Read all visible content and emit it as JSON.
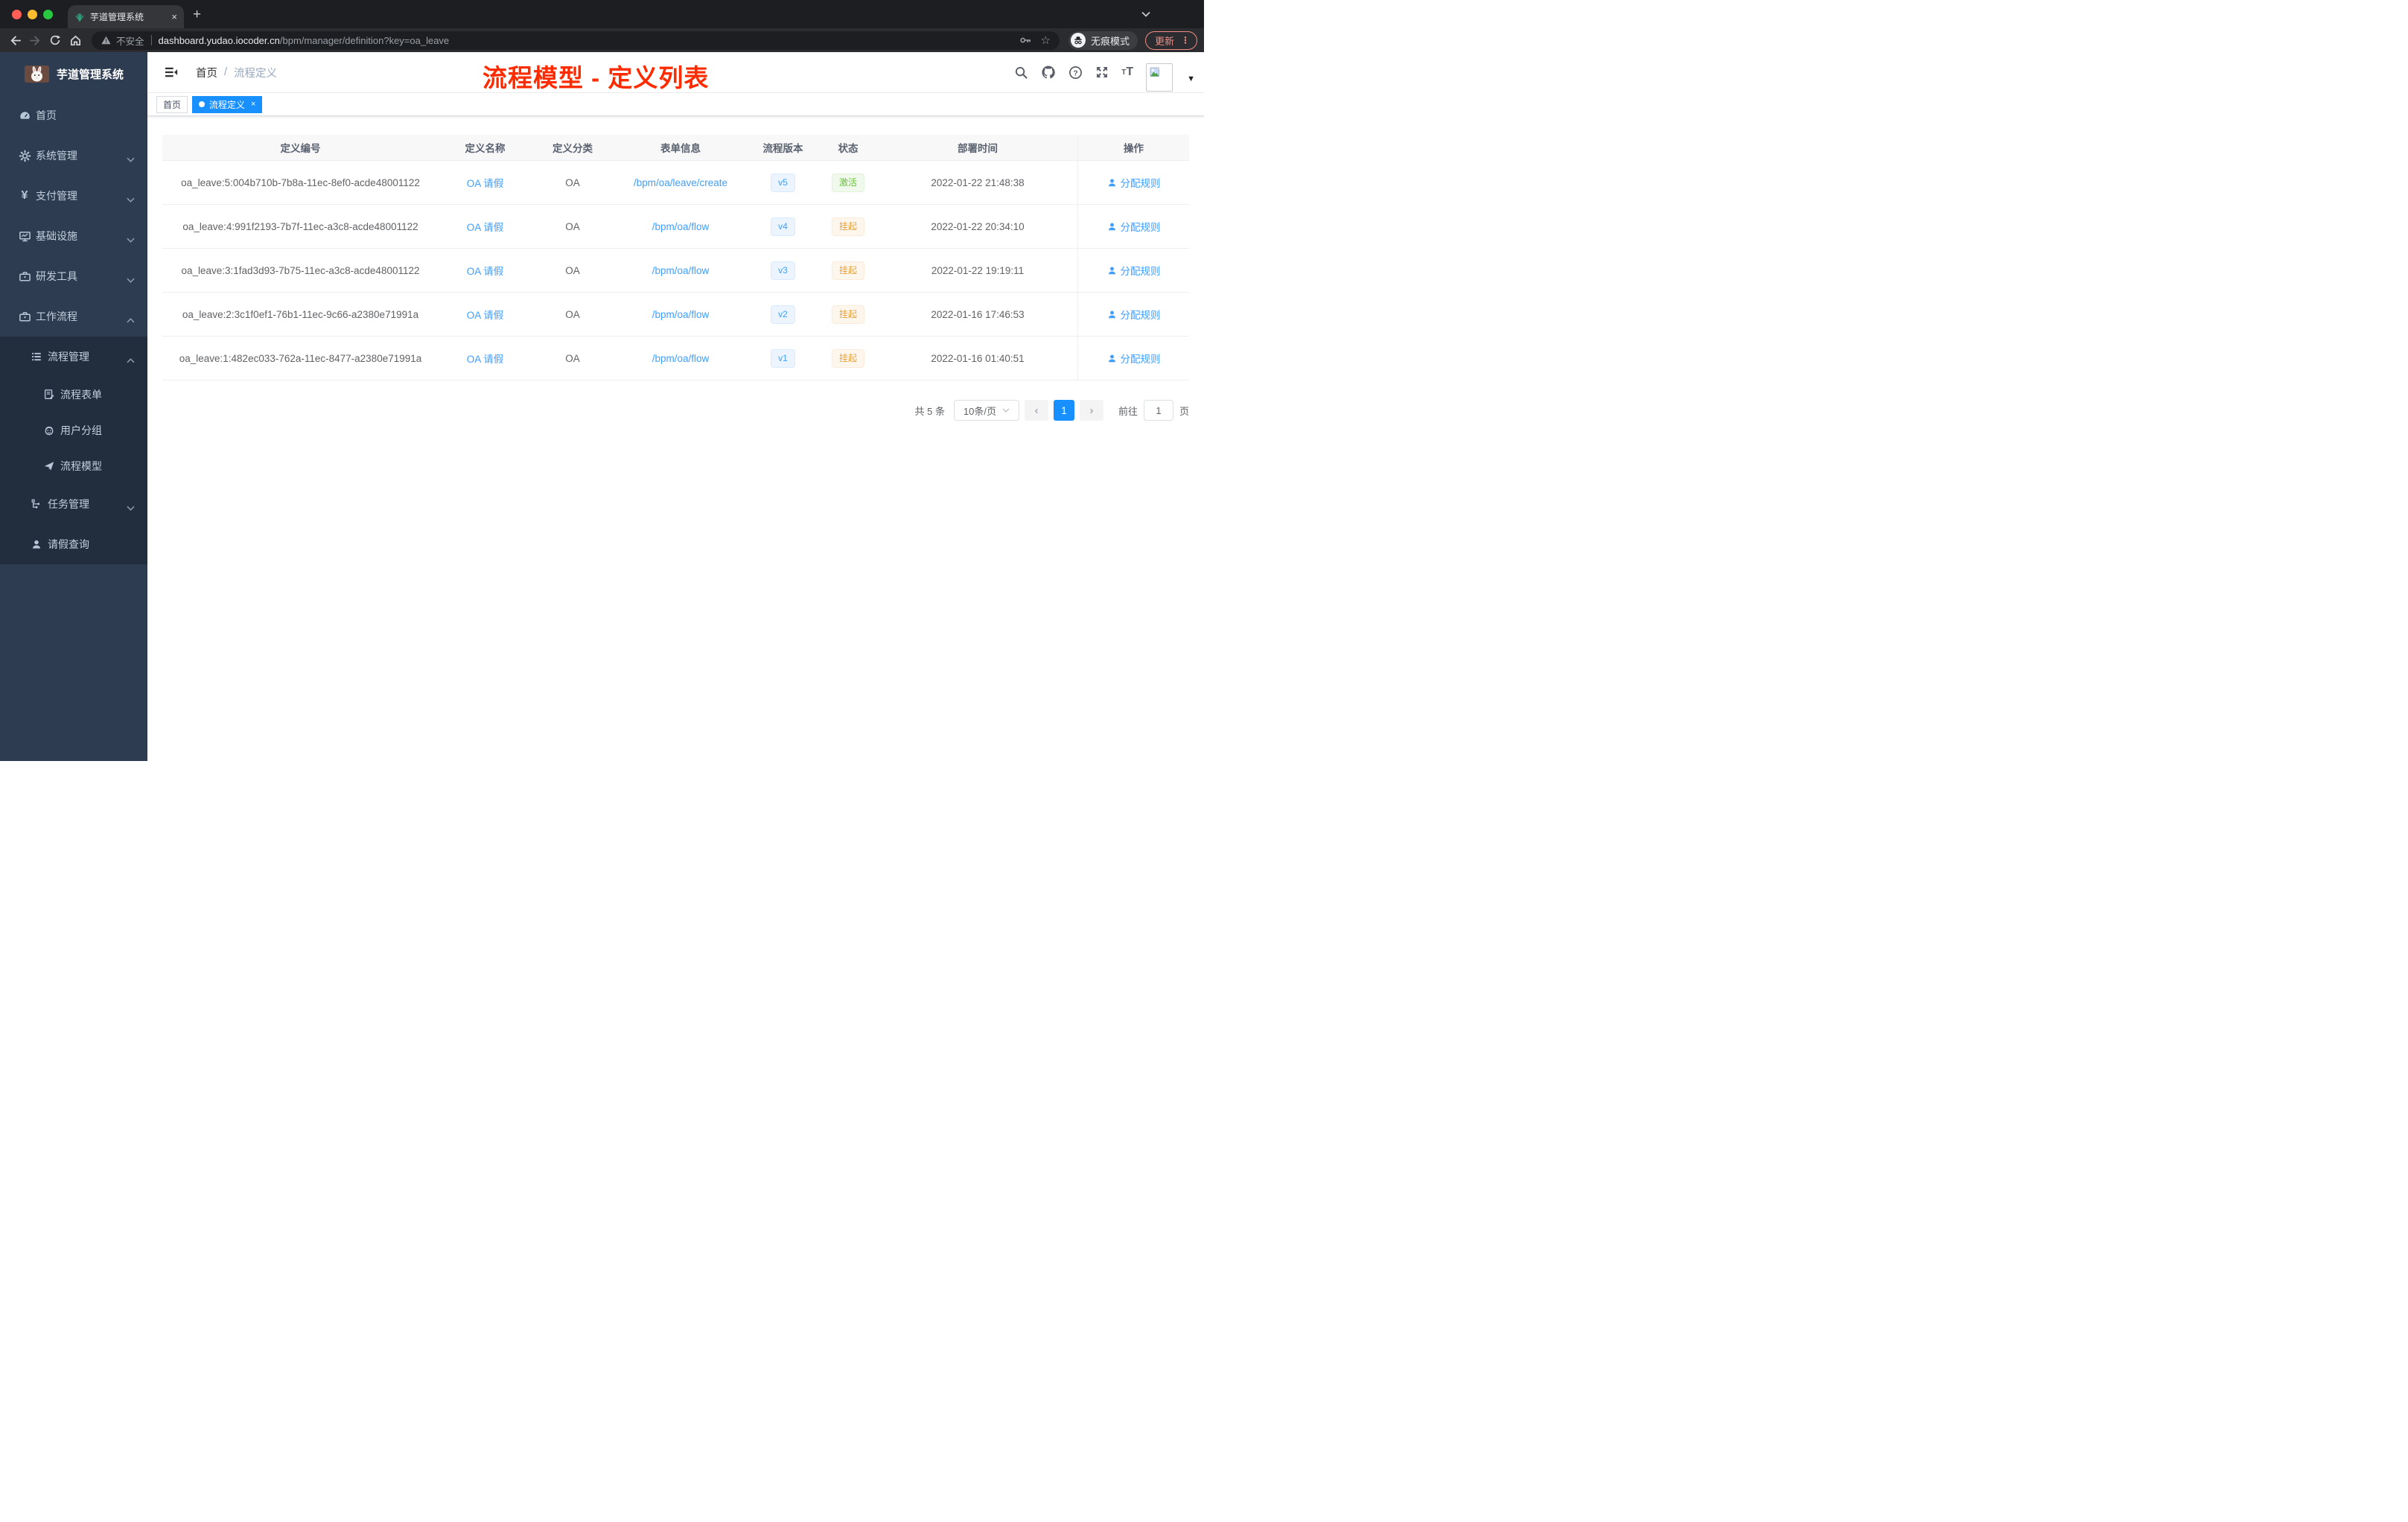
{
  "browser": {
    "tab": {
      "title": "芋道管理系统",
      "close": "×"
    },
    "new_tab": "+",
    "address": {
      "security_label": "不安全",
      "host": "dashboard.yudao.iocoder.cn",
      "path": "/bpm/manager/definition?key=oa_leave"
    },
    "incognito_label": "无痕模式",
    "update_label": "更新",
    "menu_dots": "⋮"
  },
  "sidebar": {
    "logo_title": "芋道管理系统",
    "items": [
      {
        "label": "首页",
        "icon": "dashboard-icon"
      },
      {
        "label": "系统管理",
        "icon": "gear-icon"
      },
      {
        "label": "支付管理",
        "icon": "yen-icon"
      },
      {
        "label": "基础设施",
        "icon": "monitor-icon"
      },
      {
        "label": "研发工具",
        "icon": "toolbox-icon"
      },
      {
        "label": "工作流程",
        "icon": "briefcase-icon"
      },
      {
        "label": "流程管理",
        "icon": "list-icon"
      },
      {
        "label": "流程表单",
        "icon": "form-icon"
      },
      {
        "label": "用户分组",
        "icon": "robot-icon"
      },
      {
        "label": "流程模型",
        "icon": "paper-plane-icon"
      },
      {
        "label": "任务管理",
        "icon": "flow-tree-icon"
      },
      {
        "label": "请假查询",
        "icon": "person-icon"
      }
    ],
    "yen_glyph": "¥"
  },
  "header": {
    "breadcrumb": {
      "home": "首页",
      "separator": "/",
      "current": "流程定义"
    }
  },
  "tags": {
    "home": {
      "label": "首页"
    },
    "active": {
      "label": "流程定义",
      "close": "×"
    }
  },
  "annotation": {
    "text": "流程模型 - 定义列表",
    "color": "#fd2c00"
  },
  "table": {
    "columns": [
      "定义编号",
      "定义名称",
      "定义分类",
      "表单信息",
      "流程版本",
      "状态",
      "部署时间",
      "操作"
    ],
    "rows": [
      {
        "id": "oa_leave:5:004b710b-7b8a-11ec-8ef0-acde48001122",
        "name": "OA 请假",
        "category": "OA",
        "form": "/bpm/oa/leave/create",
        "version": "v5",
        "status": "激活",
        "status_type": "success",
        "deploy_time": "2022-01-22 21:48:38",
        "action": "分配规则"
      },
      {
        "id": "oa_leave:4:991f2193-7b7f-11ec-a3c8-acde48001122",
        "name": "OA 请假",
        "category": "OA",
        "form": "/bpm/oa/flow",
        "version": "v4",
        "status": "挂起",
        "status_type": "warning",
        "deploy_time": "2022-01-22 20:34:10",
        "action": "分配规则"
      },
      {
        "id": "oa_leave:3:1fad3d93-7b75-11ec-a3c8-acde48001122",
        "name": "OA 请假",
        "category": "OA",
        "form": "/bpm/oa/flow",
        "version": "v3",
        "status": "挂起",
        "status_type": "warning",
        "deploy_time": "2022-01-22 19:19:11",
        "action": "分配规则"
      },
      {
        "id": "oa_leave:2:3c1f0ef1-76b1-11ec-9c66-a2380e71991a",
        "name": "OA 请假",
        "category": "OA",
        "form": "/bpm/oa/flow",
        "version": "v2",
        "status": "挂起",
        "status_type": "warning",
        "deploy_time": "2022-01-16 17:46:53",
        "action": "分配规则"
      },
      {
        "id": "oa_leave:1:482ec033-762a-11ec-8477-a2380e71991a",
        "name": "OA 请假",
        "category": "OA",
        "form": "/bpm/oa/flow",
        "version": "v1",
        "status": "挂起",
        "status_type": "warning",
        "deploy_time": "2022-01-16 01:40:51",
        "action": "分配规则"
      }
    ]
  },
  "pagination": {
    "total_text": "共 5 条",
    "page_size": "10条/页",
    "prev": "‹",
    "current_page": "1",
    "next": "›",
    "jump_prefix": "前往",
    "jump_value": "1",
    "jump_suffix": "页"
  },
  "colors": {
    "sidebar_bg": "#2e3c51",
    "submenu_bg": "#222d3d",
    "link_blue": "#409eff",
    "active_blue": "#1890ff",
    "success_green": "#67c23a",
    "warning_orange": "#e6a23c",
    "annotation_red": "#fd2c00",
    "update_red": "#f28b82"
  }
}
